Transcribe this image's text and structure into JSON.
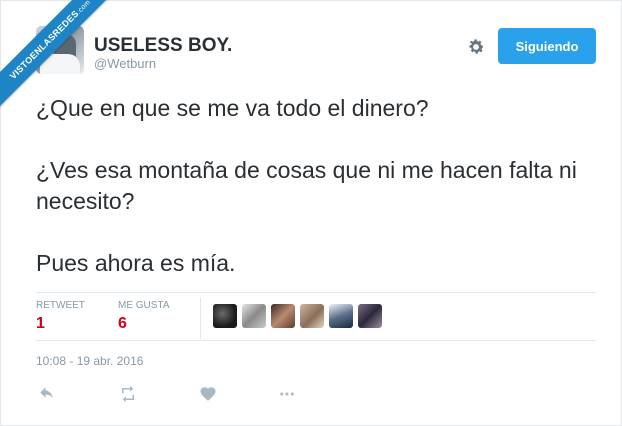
{
  "watermark": {
    "text": "VISTOENLASREDES",
    "suffix": ".com"
  },
  "user": {
    "display_name": "USELESS BOY.",
    "handle": "@Wetburn"
  },
  "header": {
    "follow_label": "Siguiendo",
    "settings_icon": "gear-icon"
  },
  "tweet": {
    "paragraphs": [
      "¿Que en que se me va todo el dinero?",
      "¿Ves esa montaña de cosas que ni me hacen falta ni necesito?",
      "Pues ahora es mía."
    ]
  },
  "stats": {
    "retweet_label": "RETWEET",
    "retweet_count": "1",
    "likes_label": "ME GUSTA",
    "likes_count": "6"
  },
  "timestamp": "10:08 - 19 abr. 2016",
  "actions": [
    "reply-icon",
    "retweet-icon",
    "like-icon",
    "more-icon"
  ],
  "colors": {
    "accent": "#2aa1eb",
    "stat_red": "#d0021b",
    "muted": "#8899a6",
    "ribbon": "#1f84c6"
  }
}
